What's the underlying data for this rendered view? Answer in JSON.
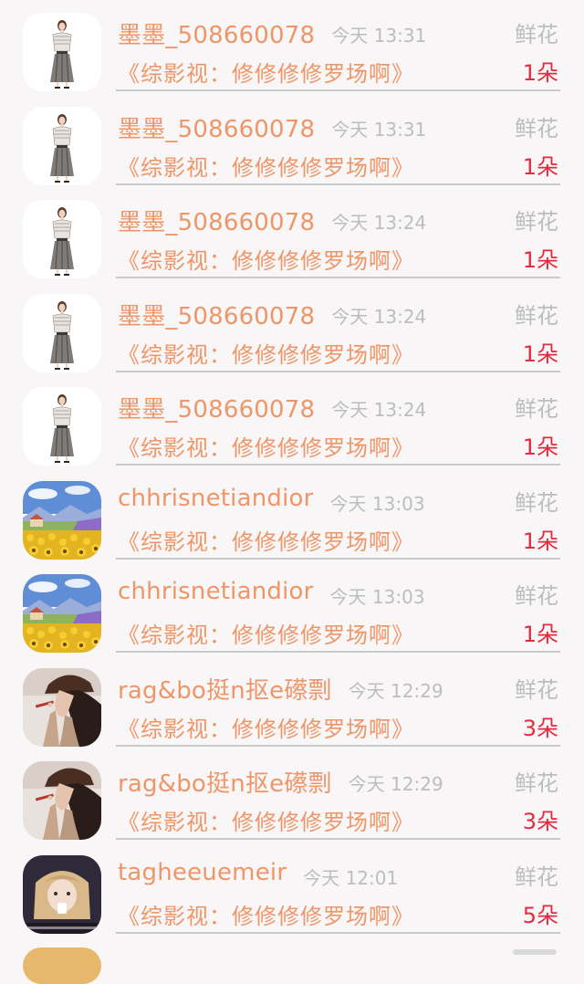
{
  "records": [
    {
      "name": "墨墨_508660078",
      "time": "今天 13:31",
      "gift": "鲜花",
      "work": "《综影视：修修修修罗场啊》",
      "count": "1朵",
      "avatar": "fashion-girl-avatar"
    },
    {
      "name": "墨墨_508660078",
      "time": "今天 13:31",
      "gift": "鲜花",
      "work": "《综影视：修修修修罗场啊》",
      "count": "1朵",
      "avatar": "fashion-girl-avatar"
    },
    {
      "name": "墨墨_508660078",
      "time": "今天 13:24",
      "gift": "鲜花",
      "work": "《综影视：修修修修罗场啊》",
      "count": "1朵",
      "avatar": "fashion-girl-avatar"
    },
    {
      "name": "墨墨_508660078",
      "time": "今天 13:24",
      "gift": "鲜花",
      "work": "《综影视：修修修修罗场啊》",
      "count": "1朵",
      "avatar": "fashion-girl-avatar"
    },
    {
      "name": "墨墨_508660078",
      "time": "今天 13:24",
      "gift": "鲜花",
      "work": "《综影视：修修修修罗场啊》",
      "count": "1朵",
      "avatar": "fashion-girl-avatar"
    },
    {
      "name": "chhrisnetiandior",
      "time": "今天 13:03",
      "gift": "鲜花",
      "work": "《综影视：修修修修罗场啊》",
      "count": "1朵",
      "avatar": "landscape-painting-avatar"
    },
    {
      "name": "chhrisnetiandior",
      "time": "今天 13:03",
      "gift": "鲜花",
      "work": "《综影视：修修修修罗场啊》",
      "count": "1朵",
      "avatar": "landscape-painting-avatar"
    },
    {
      "name": "rag&bo挺n抠e礤剽",
      "time": "今天 12:29",
      "gift": "鲜花",
      "work": "《综影视：修修修修罗场啊》",
      "count": "3朵",
      "avatar": "woman-hat-avatar"
    },
    {
      "name": "rag&bo挺n抠e礤剽",
      "time": "今天 12:29",
      "gift": "鲜花",
      "work": "《综影视：修修修修罗场啊》",
      "count": "3朵",
      "avatar": "woman-hat-avatar"
    },
    {
      "name": "tagheeuemeir",
      "time": "今天 12:01",
      "gift": "鲜花",
      "work": "《综影视：修修修修罗场啊》",
      "count": "5朵",
      "avatar": "blonde-girl-avatar"
    }
  ],
  "colors": {
    "name": "#ef9668",
    "muted": "#bdbdbd",
    "count": "#e32b3f",
    "background": "#f8f6f7"
  }
}
